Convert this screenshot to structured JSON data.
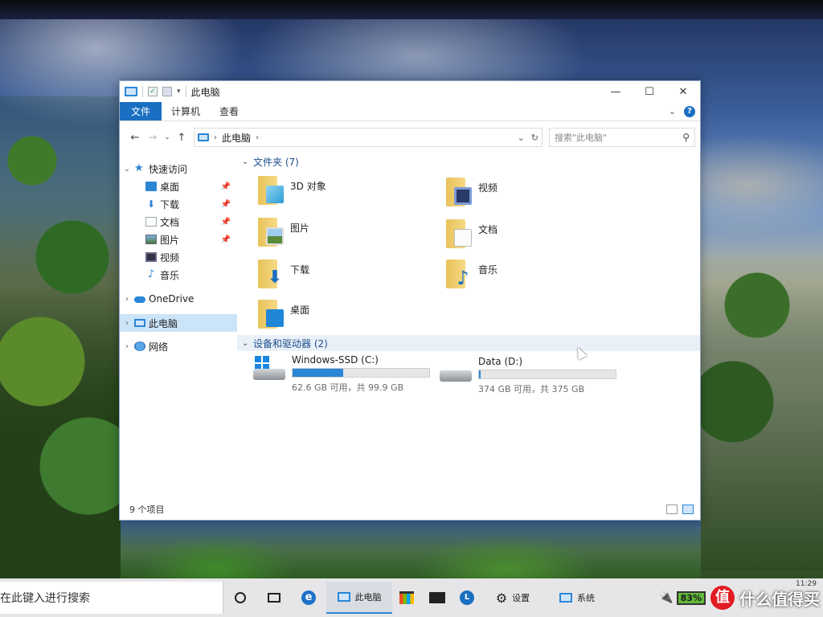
{
  "window": {
    "title": "此电脑",
    "controls": {
      "minimize": "—",
      "maximize": "☐",
      "close": "✕"
    }
  },
  "ribbon": {
    "tabs": [
      "文件",
      "计算机",
      "查看"
    ],
    "help": "?",
    "collapse": "⌄"
  },
  "address": {
    "breadcrumb": "此电脑",
    "search_placeholder": "搜索\"此电脑\""
  },
  "nav": {
    "quick_access": "快速访问",
    "quick_items": [
      {
        "label": "桌面",
        "icon": "desktop-icon",
        "pinned": true
      },
      {
        "label": "下载",
        "icon": "download-icon",
        "pinned": true
      },
      {
        "label": "文档",
        "icon": "document-icon",
        "pinned": true
      },
      {
        "label": "图片",
        "icon": "picture-icon",
        "pinned": true
      },
      {
        "label": "视频",
        "icon": "video-icon",
        "pinned": false
      },
      {
        "label": "音乐",
        "icon": "music-icon",
        "pinned": false
      }
    ],
    "onedrive": "OneDrive",
    "this_pc": "此电脑",
    "network": "网络"
  },
  "folders": {
    "header": "文件夹 (7)",
    "items": [
      {
        "label": "3D 对象",
        "icon": "3d-objects-folder-icon"
      },
      {
        "label": "视频",
        "icon": "videos-folder-icon"
      },
      {
        "label": "图片",
        "icon": "pictures-folder-icon"
      },
      {
        "label": "文档",
        "icon": "documents-folder-icon"
      },
      {
        "label": "下载",
        "icon": "downloads-folder-icon"
      },
      {
        "label": "音乐",
        "icon": "music-folder-icon"
      },
      {
        "label": "桌面",
        "icon": "desktop-folder-icon"
      }
    ]
  },
  "drives": {
    "header": "设备和驱动器 (2)",
    "items": [
      {
        "name": "Windows-SSD (C:)",
        "free_text": "62.6 GB 可用，共 99.9 GB",
        "used_fraction": 0.373,
        "icon": "windows-drive-icon"
      },
      {
        "name": "Data (D:)",
        "free_text": "374 GB 可用，共 375 GB",
        "used_fraction": 0.003,
        "icon": "hard-drive-icon"
      }
    ]
  },
  "status": {
    "items_count": "9 个项目"
  },
  "taskbar": {
    "search_text": "在此键入进行搜索",
    "explorer_label": "此电脑",
    "settings_label": "设置",
    "system_label": "系统",
    "battery": "83%",
    "time": "11:29"
  },
  "watermark": {
    "text": "什么值得买",
    "logo": "值"
  },
  "colors": {
    "accent": "#1a6fc2",
    "selection": "#cce4f7",
    "drive_fill": "#2a86d6",
    "battery": "#63b83a"
  }
}
